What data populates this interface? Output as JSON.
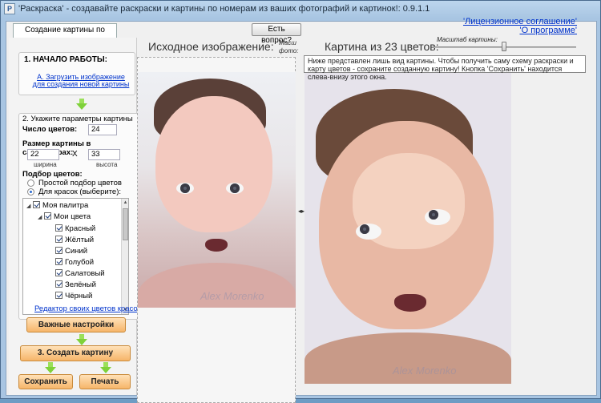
{
  "window": {
    "icon": "P",
    "title": "'Раскраска' - создавайте раскраски и картины по номерам из ваших фотографий и картинок!: 0.9.1.1"
  },
  "tabs": [
    "Создание картины по номерам"
  ],
  "help_button": "Есть вопрос?",
  "links": {
    "license": "'Лицензионное соглашение'",
    "about": "'О программе'"
  },
  "step1": {
    "title": "1. НАЧАЛО РАБОТЫ:",
    "load_link": "А. Загрузить изображение для создания новой картины"
  },
  "step2": {
    "title": "2. Укажите параметры картины",
    "colors_label": "Число цветов:",
    "colors_value": "24",
    "size_label": "Размер картины в сантиметрах:",
    "width_value": "22",
    "times": "X",
    "height_value": "33",
    "width_caption": "ширина",
    "height_caption": "высота",
    "color_select_label": "Подбор цветов:",
    "option_simple": "Простой подбор цветов",
    "option_paints": "Для красок (выберите):"
  },
  "palette_tree": {
    "root": "Моя палитра",
    "group": "Мои цвета",
    "colors": [
      {
        "name": "Красный",
        "hex": "#ee1111"
      },
      {
        "name": "Жёлтый",
        "hex": "#ffee00"
      },
      {
        "name": "Синий",
        "hex": "#1111ee"
      },
      {
        "name": "Голубой",
        "hex": "#77bbee"
      },
      {
        "name": "Салатовый",
        "hex": "#22ee11"
      },
      {
        "name": "Зелёный",
        "hex": "#118811"
      },
      {
        "name": "Чёрный",
        "hex": "#000000"
      }
    ]
  },
  "editor_link": "Редактор своих цветов красок",
  "buttons": {
    "important_settings": "Важные настройки",
    "create": "3. Создать картину",
    "save": "Сохранить",
    "print": "Печать"
  },
  "panels": {
    "source_title": "Исходное изображение:",
    "source_cut": "Масш фото:",
    "result_title": "Картина из 23 цветов:",
    "scale_label": "Масштаб картины:"
  },
  "tooltip": "Ниже представлен лишь вид картины. Чтобы получить саму схему раскраски и карту цветов - сохраните созданную картину! Кнопка 'Сохранить' находится слева-внизу этого окна.",
  "watermark": "Alex Morenko",
  "icons": {
    "app": "app-icon",
    "arrow": "arrow-down-icon",
    "expand": "triangle-down-icon"
  }
}
